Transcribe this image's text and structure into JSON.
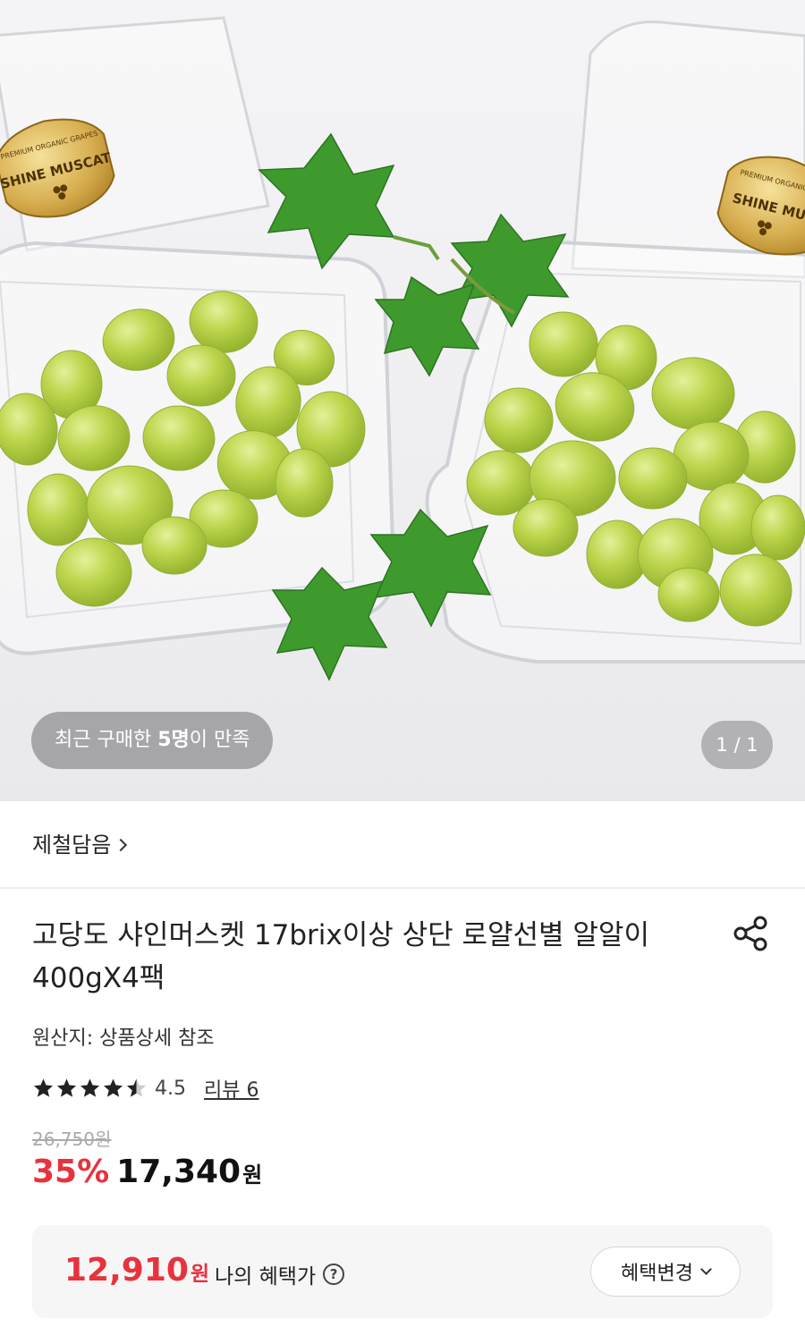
{
  "hero": {
    "label_left": "SHINE MUSCAT",
    "label_right": "SHINE MU",
    "buyers_prefix": "최근 구매한 ",
    "buyers_count": "5명",
    "buyers_suffix": "이 만족",
    "pager": "1 / 1"
  },
  "seller": {
    "name": "제철담음"
  },
  "product": {
    "title": "고당도 샤인머스켓 17brix이상 상단 로얄선별 알알이 400gX4팩",
    "origin": "원산지: 상품상세 참조",
    "rating": "4.5",
    "rating_value": 4.5,
    "reviews": "리뷰 6",
    "original_price": "26,750원",
    "discount": "35%",
    "price": "17,340",
    "currency": "원"
  },
  "benefit": {
    "price": "12,910",
    "currency": "원",
    "label": "나의 혜택가",
    "help": "?",
    "button": "혜택변경"
  },
  "colors": {
    "accent": "#e8323c",
    "grape": "#b5cf47",
    "leaf": "#3f9a2e"
  },
  "icons": {
    "share": "share-icon",
    "star": "star-icon",
    "help": "help-circle-icon",
    "chevron": "chevron-down-icon"
  }
}
